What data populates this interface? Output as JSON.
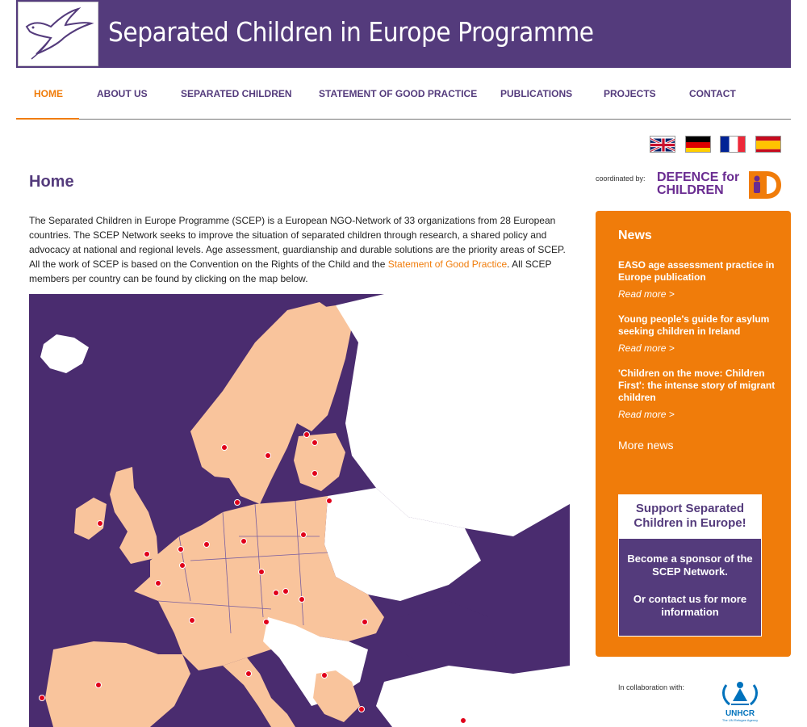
{
  "header": {
    "title": "Separated Children in Europe Programme",
    "logo_icon": "dove-logo-icon",
    "brand_color": "#543b7c"
  },
  "nav": {
    "items": [
      {
        "label": "HOME",
        "active": true
      },
      {
        "label": "ABOUT US"
      },
      {
        "label": "SEPARATED CHILDREN"
      },
      {
        "label": "STATEMENT OF GOOD PRACTICE"
      },
      {
        "label": "PUBLICATIONS"
      },
      {
        "label": "PROJECTS"
      },
      {
        "label": "CONTACT"
      }
    ],
    "active_color": "#f07c0a"
  },
  "languages": [
    "uk-flag-icon",
    "german-flag-icon",
    "french-flag-icon",
    "spanish-flag-icon"
  ],
  "main": {
    "title": "Home",
    "intro_part1": "The Separated Children in Europe Programme (SCEP) is a European NGO-Network of 33 organizations from 28 European countries. The SCEP Network seeks to improve the situation of separated children through research, a shared policy and advocacy at national and regional levels. Age assessment, guardianship and durable solutions are the priority areas of SCEP. All the work of SCEP is based on the Convention on the Rights of the Child and the ",
    "intro_link": "Statement of Good Practice",
    "intro_part2": ". All SCEP members per country can be found by clicking on the map below.",
    "map": {
      "member_color": "#f9c49c",
      "other_color": "#ffffff",
      "sea_color": "#4a2c6f",
      "marker_color": "#e0001a"
    }
  },
  "sidebar": {
    "coordinated_label": "coordinated by:",
    "dci_name_line1": "DEFENCE for",
    "dci_name_line2": "CHILDREN",
    "news": {
      "title": "News",
      "items": [
        {
          "title": "EASO age assessment practice in Europe publication",
          "more": "Read more >"
        },
        {
          "title": "Young people's guide for asylum seeking children in Ireland",
          "more": "Read more >"
        },
        {
          "title": "'Children on the move: Children First': the intense story of migrant children",
          "more": "Read more >"
        }
      ],
      "more_news": "More news"
    },
    "support": {
      "headline": "Support Separated Children in Europe!",
      "sponsor": "Become a sponsor of the SCEP Network.",
      "contact": "Or contact us for more information"
    },
    "collab_label": "In collaboration with:",
    "unhcr_name": "UNHCR",
    "unhcr_sub": "The UN Refugee Agency"
  }
}
